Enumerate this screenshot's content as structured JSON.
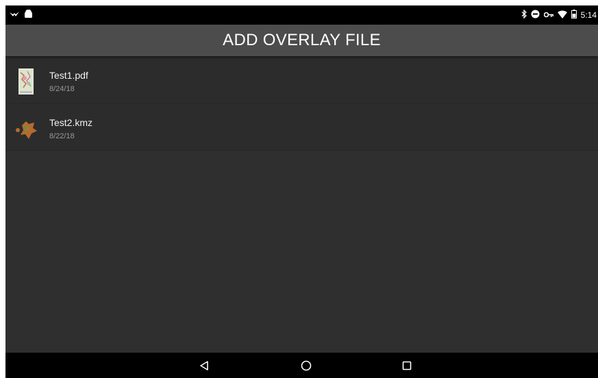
{
  "status_bar": {
    "time": "5:14",
    "left_icons": [
      "notification-bird-icon",
      "android-icon"
    ],
    "right_icons": [
      "bluetooth-icon",
      "do-not-disturb-icon",
      "vpn-key-icon",
      "wifi-icon",
      "battery-icon"
    ]
  },
  "app_bar": {
    "title": "ADD OVERLAY FILE"
  },
  "files": [
    {
      "name": "Test1.pdf",
      "date": "8/24/18",
      "thumb_icon": "pdf-map-thumbnail-icon"
    },
    {
      "name": "Test2.kmz",
      "date": "8/22/18",
      "thumb_icon": "kmz-map-thumbnail-icon"
    }
  ],
  "nav_bar": {
    "buttons": [
      "back-icon",
      "home-icon",
      "recents-icon"
    ]
  },
  "colors": {
    "background": "#2f2f2f",
    "app_bar": "#4c4c4c",
    "status_bar": "#000000",
    "text_primary": "#f2f2f2",
    "text_secondary": "#9a9a9a"
  }
}
